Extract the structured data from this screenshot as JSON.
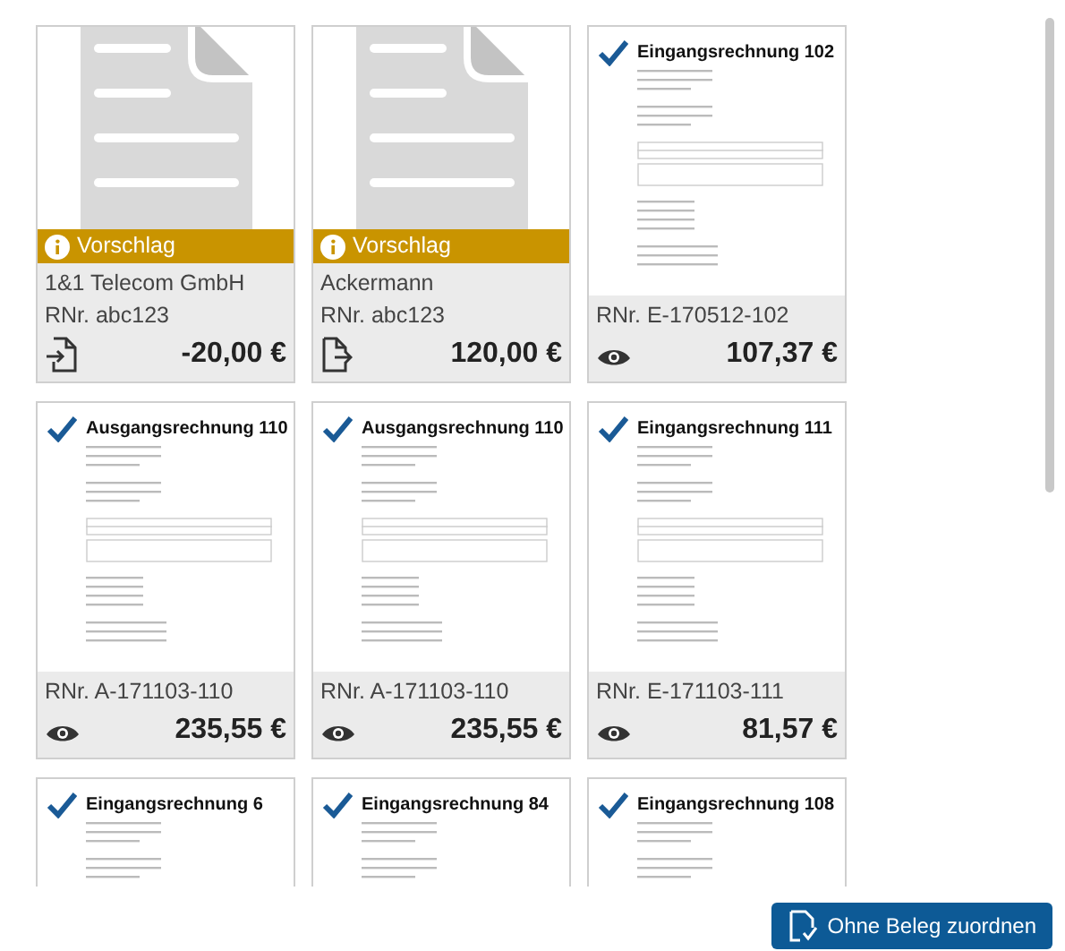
{
  "cards": [
    {
      "kind": "suggestion",
      "banner": "Vorschlag",
      "name": "1&1 Telecom GmbH",
      "reference": "RNr. abc123",
      "action": {
        "kind": "import"
      },
      "amount": "-20,00 €"
    },
    {
      "kind": "suggestion",
      "banner": "Vorschlag",
      "name": "Ackermann",
      "reference": "RNr. abc123",
      "action": {
        "kind": "export"
      },
      "amount": "120,00 €"
    },
    {
      "kind": "document",
      "checked": true,
      "doc_title": "Eingangsrechnung 102",
      "reference": "RNr. E-170512-102",
      "action": {
        "kind": "view"
      },
      "amount": "107,37 €"
    },
    {
      "kind": "document",
      "checked": true,
      "doc_title": "Ausgangsrechnung 110",
      "reference": "RNr. A-171103-110",
      "action": {
        "kind": "view"
      },
      "amount": "235,55 €"
    },
    {
      "kind": "document",
      "checked": true,
      "doc_title": "Ausgangsrechnung 110",
      "reference": "RNr. A-171103-110",
      "action": {
        "kind": "view"
      },
      "amount": "235,55 €"
    },
    {
      "kind": "document",
      "checked": true,
      "doc_title": "Eingangsrechnung 111",
      "reference": "RNr. E-171103-111",
      "action": {
        "kind": "view"
      },
      "amount": "81,57 €"
    },
    {
      "kind": "document",
      "checked": true,
      "doc_title": "Eingangsrechnung 6"
    },
    {
      "kind": "document",
      "checked": true,
      "doc_title": "Eingangsrechnung 84"
    },
    {
      "kind": "document",
      "checked": true,
      "doc_title": "Eingangsrechnung 108"
    }
  ],
  "assign_button": "Ohne Beleg zuordnen"
}
